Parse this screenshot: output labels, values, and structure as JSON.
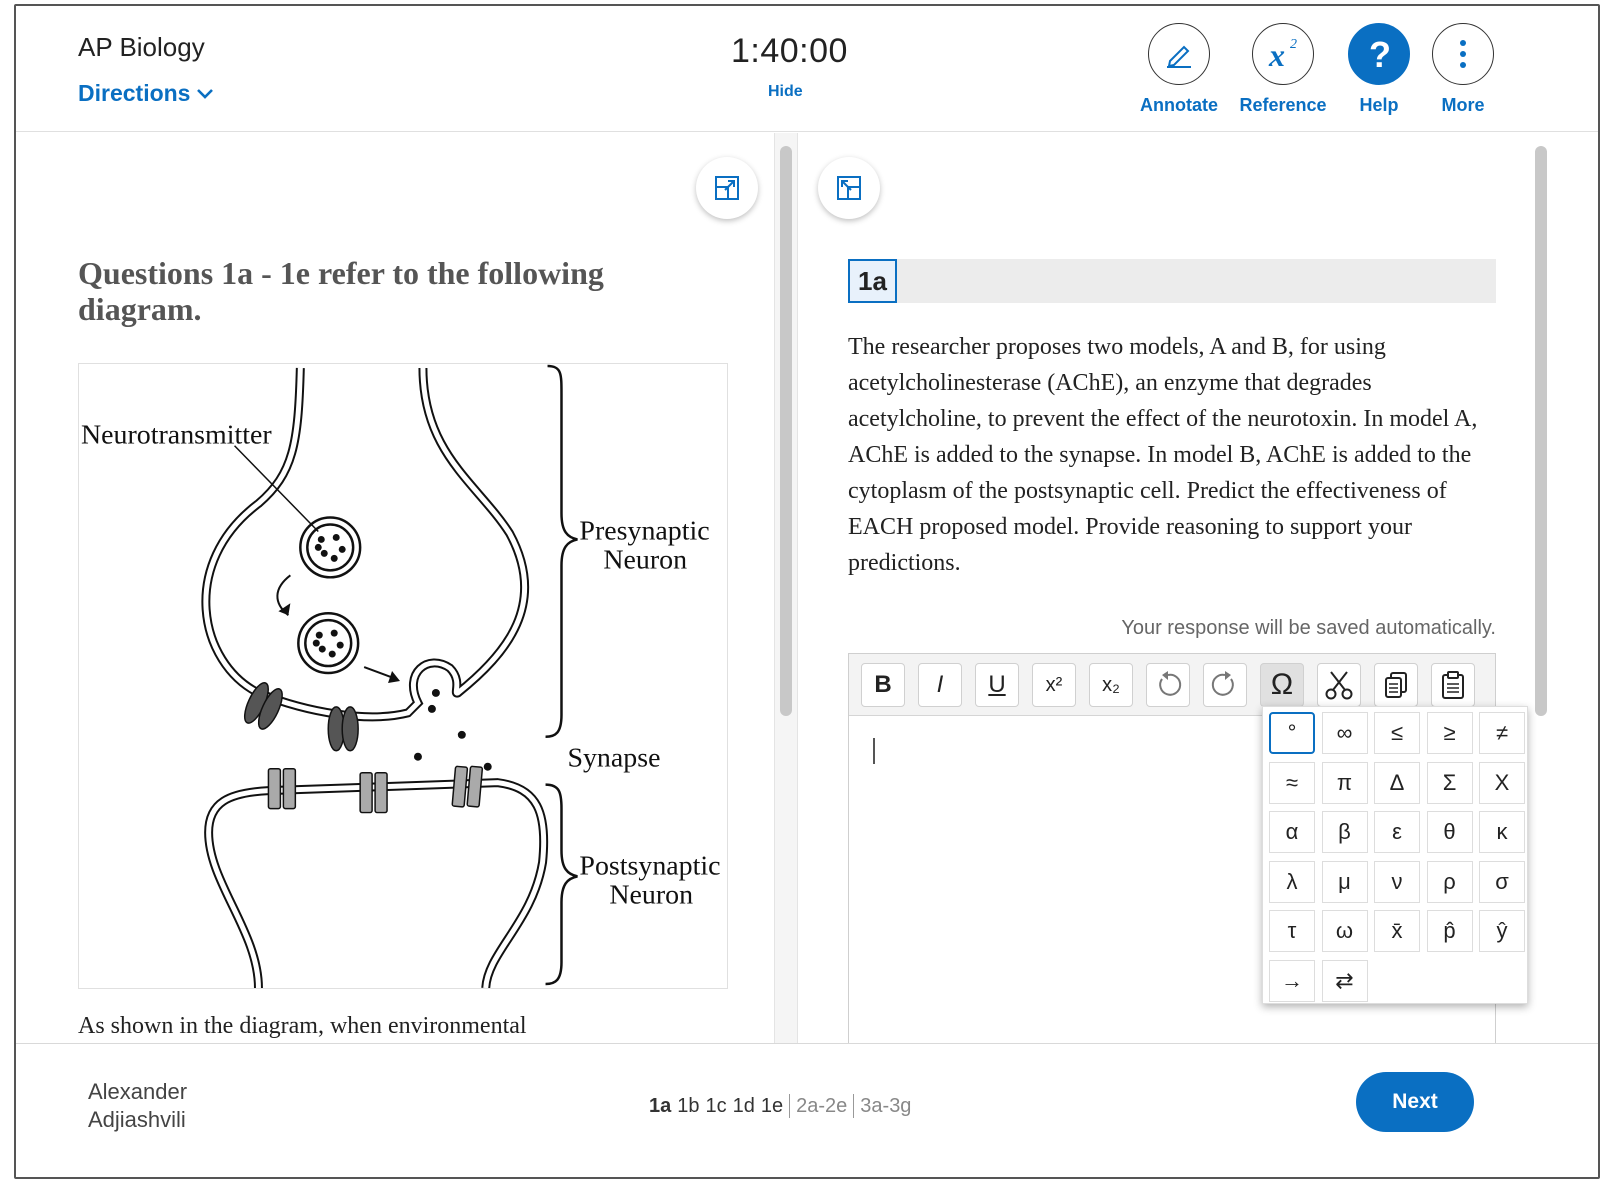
{
  "header": {
    "app_title": "AP Biology",
    "directions_label": "Directions",
    "timer": "1:40:00",
    "hide_label": "Hide",
    "tools": {
      "annotate": "Annotate",
      "reference": "Reference",
      "help": "Help",
      "more": "More"
    }
  },
  "stimulus": {
    "heading": "Questions 1a - 1e refer to the following diagram.",
    "diagram_labels": {
      "neurotransmitter": "Neurotransmitter",
      "presynaptic_1": "Presynaptic",
      "presynaptic_2": "Neuron",
      "synapse": "Synapse",
      "postsynaptic_1": "Postsynaptic",
      "postsynaptic_2": "Neuron"
    },
    "body_text": "As shown in the diagram, when environmental"
  },
  "question": {
    "label": "1a",
    "text": "The researcher proposes two models, A and B, for using acetylcholinesterase (AChE), an enzyme that degrades acetylcholine, to prevent the effect of the neurotoxin. In model A, AChE is added to the synapse.  In model B, AChE is added to the cytoplasm of the postsynaptic cell. Predict the effectiveness of EACH proposed model. Provide reasoning to support your predictions.",
    "autosave_note": "Your response will be saved automatically."
  },
  "editor_toolbar": {
    "bold": "B",
    "italic": "I",
    "underline": "U",
    "superscript": "x²",
    "subscript": "x₂",
    "special_chars": "Ω"
  },
  "special_characters": [
    "°",
    "∞",
    "≤",
    "≥",
    "≠",
    "≈",
    "π",
    "Δ",
    "Σ",
    "Χ",
    "α",
    "β",
    "ε",
    "θ",
    "κ",
    "λ",
    "μ",
    "ν",
    "ρ",
    "σ",
    "τ",
    "ω",
    "x̄",
    "p̂",
    "ŷ",
    "→",
    "⇄"
  ],
  "footer": {
    "student_first": "Alexander",
    "student_last": "Adjiashvili",
    "question_nav": [
      "1a",
      "1b",
      "1c",
      "1d",
      "1e"
    ],
    "group_nav": [
      "2a-2e",
      "3a-3g"
    ],
    "next_label": "Next"
  },
  "colors": {
    "accent": "#0a6fc2"
  }
}
